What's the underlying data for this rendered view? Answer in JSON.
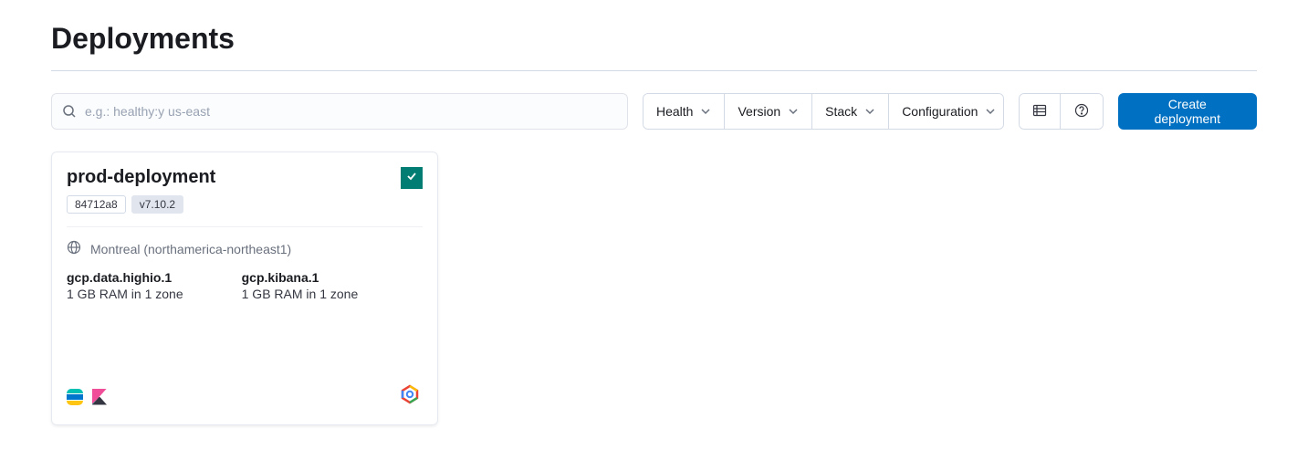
{
  "page": {
    "title": "Deployments"
  },
  "search": {
    "placeholder": "e.g.: healthy:y us-east"
  },
  "filters": {
    "health": "Health",
    "version": "Version",
    "stack": "Stack",
    "configuration": "Configuration"
  },
  "actions": {
    "create": "Create deployment"
  },
  "deployment": {
    "name": "prod-deployment",
    "id_badge": "84712a8",
    "version_badge": "v7.10.2",
    "region": "Montreal (northamerica-northeast1)",
    "instances": [
      {
        "name": "gcp.data.highio.1",
        "spec": "1 GB RAM in 1 zone"
      },
      {
        "name": "gcp.kibana.1",
        "spec": "1 GB RAM in 1 zone"
      }
    ],
    "status": "healthy"
  }
}
